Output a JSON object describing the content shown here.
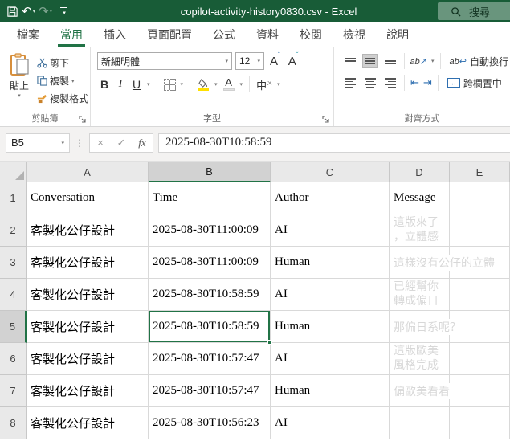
{
  "titlebar": {
    "title": "copilot-activity-history0830.csv - Excel",
    "search_label": "搜尋"
  },
  "icons": {
    "dropdown": "▾",
    "undo": "↶",
    "redo": "↷",
    "dots": "⋮",
    "caret_up": "ˆ",
    "caret_down": "ˇ",
    "indent_dec": "⇤",
    "indent_inc": "⇥",
    "orientation_ab": "ab",
    "orientation_arrow": "↗",
    "wrap_arrow": "↩",
    "merge_arrows": "↔",
    "letter_a": "A",
    "phonetic_mark": "ㄨ"
  },
  "tabs": {
    "items": [
      "檔案",
      "常用",
      "插入",
      "頁面配置",
      "公式",
      "資料",
      "校閱",
      "檢視",
      "說明"
    ],
    "active": "常用"
  },
  "ribbon": {
    "clipboard": {
      "paste": "貼上",
      "cut": "剪下",
      "copy": "複製",
      "format_painter": "複製格式",
      "label": "剪貼簿"
    },
    "font": {
      "family": "新細明體",
      "size": "12",
      "bold": "B",
      "italic": "I",
      "underline": "U",
      "phonetic": "中",
      "label": "字型"
    },
    "alignment": {
      "wrap_text": "自動換行",
      "merge_center": "跨欄置中",
      "label": "對齊方式"
    }
  },
  "formula_bar": {
    "name_box": "B5",
    "cancel": "×",
    "enter": "✓",
    "fx": "fx",
    "value": "2025-08-30T10:58:59"
  },
  "sheet": {
    "col_headers": [
      "A",
      "B",
      "C",
      "D",
      "E"
    ],
    "selected_cell": "B5",
    "rows": [
      {
        "num": "1",
        "conv": "Conversation",
        "time": "Time",
        "author": "Author",
        "msg": "Message"
      },
      {
        "num": "2",
        "conv": "客製化公仔設計",
        "time": "2025-08-30T11:00:09",
        "author": "AI",
        "msg": "這版來了\n，立體感"
      },
      {
        "num": "3",
        "conv": "客製化公仔設計",
        "time": "2025-08-30T11:00:09",
        "author": "Human",
        "msg": "這樣沒有公仔的立體"
      },
      {
        "num": "4",
        "conv": "客製化公仔設計",
        "time": "2025-08-30T10:58:59",
        "author": "AI",
        "msg": "已經幫你\n轉成偏日"
      },
      {
        "num": "5",
        "conv": "客製化公仔設計",
        "time": "2025-08-30T10:58:59",
        "author": "Human",
        "msg": "那偏日系呢？"
      },
      {
        "num": "6",
        "conv": "客製化公仔設計",
        "time": "2025-08-30T10:57:47",
        "author": "AI",
        "msg": "這版歐美\n風格完成"
      },
      {
        "num": "7",
        "conv": "客製化公仔設計",
        "time": "2025-08-30T10:57:47",
        "author": "Human",
        "msg": "偏歐美看看"
      },
      {
        "num": "8",
        "conv": "客製化公仔設計",
        "time": "2025-08-30T10:56:23",
        "author": "AI",
        "msg": ""
      }
    ]
  }
}
